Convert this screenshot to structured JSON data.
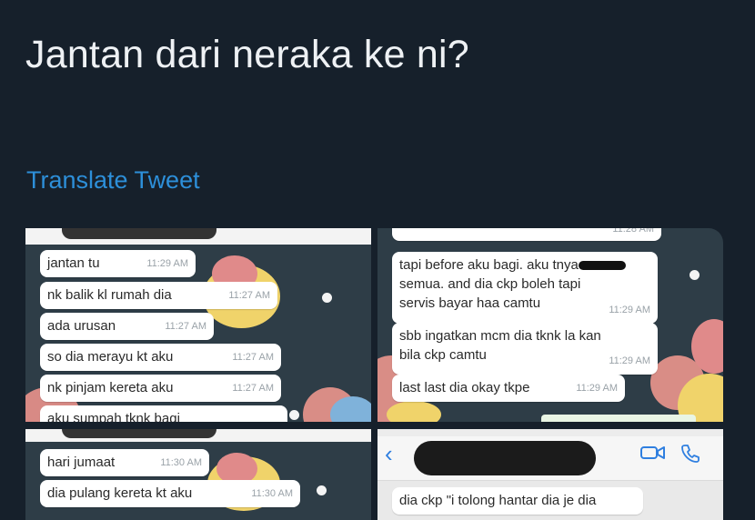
{
  "tweet": {
    "text": "Jantan dari neraka ke ni?",
    "translate_label": "Translate Tweet"
  },
  "panel1": {
    "messages": [
      {
        "text": "jantan tu",
        "time": "11:29 AM"
      },
      {
        "text": "nk balik kl rumah dia",
        "time": "11:27 AM"
      },
      {
        "text": "ada urusan",
        "time": "11:27 AM"
      },
      {
        "text": "so dia merayu kt aku",
        "time": "11:27 AM"
      },
      {
        "text": "nk pinjam kereta aku",
        "time": "11:27 AM"
      },
      {
        "text": "aku sumpah tknk bagi",
        "time": ""
      }
    ]
  },
  "panel2": {
    "top_time": "11:28 AM",
    "messages": [
      {
        "line1": "tapi before aku bagi. aku tnya",
        "line2": "semua. and dia ckp boleh tapi",
        "line3": "servis bayar haa camtu",
        "time": "11:29 AM"
      },
      {
        "line1": "sbb ingatkan mcm dia tknk la kan",
        "line2": "bila ckp camtu",
        "time": "11:29 AM"
      },
      {
        "text": "last last dia okay tkpe",
        "time": "11:29 AM"
      }
    ]
  },
  "panel3": {
    "messages": [
      {
        "text": "hari jumaat",
        "time": "11:30 AM"
      },
      {
        "text": "dia pulang kereta kt aku",
        "time": "11:30 AM"
      }
    ]
  },
  "panel4": {
    "messages": [
      {
        "text": "dia ckp \"i tolong hantar dia je dia"
      }
    ]
  },
  "colors": {
    "background": "#16202b",
    "link": "#2d8fd9",
    "wallpaper": "#2e3d47",
    "bubble": "#ffffff"
  }
}
